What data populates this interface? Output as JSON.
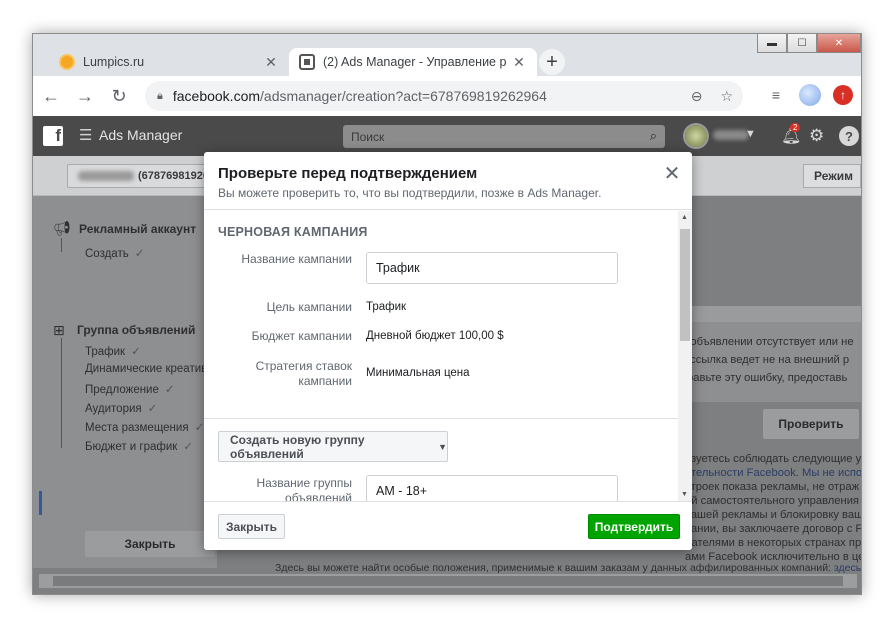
{
  "window": {
    "controls": {
      "minimize": "▬",
      "maximize": "☐",
      "close": "✕"
    }
  },
  "tabs": [
    {
      "title": "Lumpics.ru",
      "icon": "orange-circle-favicon",
      "close": "✕"
    },
    {
      "title": "(2) Ads Manager - Управление р",
      "icon": "ads-manager-favicon",
      "close": "✕"
    }
  ],
  "new_tab": "+",
  "toolbar": {
    "back": "←",
    "forward": "→",
    "reload": "↻",
    "url_host": "facebook.com",
    "url_path": "/adsmanager/creation?act=678769819262964"
  },
  "fb": {
    "logo": "f",
    "menu": "☰",
    "app_title": "Ads Manager",
    "search_placeholder": "Поиск",
    "notification_count": "2",
    "help": "?"
  },
  "subbar": {
    "account_id_suffix": "(67876981926",
    "mode_label": "Режим"
  },
  "left_panel": {
    "account_title": "Рекламный аккаунт",
    "account_items": [
      {
        "label": "Создать"
      }
    ],
    "adset_title": "Группа объявлений",
    "adset_items": [
      {
        "label": "Трафик"
      },
      {
        "label": "Динамические креатив"
      },
      {
        "label": "Предложение"
      },
      {
        "label": "Аудитория"
      },
      {
        "label": "Места размещения"
      },
      {
        "label": "Бюджет и график"
      }
    ],
    "close_label": "Закрыть"
  },
  "right_panel": {
    "lines_top": [
      "и объявлении отсутствует или не",
      "я ссылка ведет не на внешний р",
      "правьте эту ошибку, предоставь"
    ],
    "check_label": "Проверить",
    "lines_bottom": [
      "язуетесь соблюдать следующие ус",
      "ательности Facebook. Мы не испол",
      "строек показа рекламы, не отраж",
      "ий самостоятельного управления р",
      "вашей рекламы и блокировку ваше",
      "пании, вы заключаете договор с F",
      "дателями в некоторых странах при ол",
      "ами Facebook исключительно в це"
    ],
    "last_line": "Здесь вы можете найти особые положения, применимые к вашим заказам у данных аффилированных компаний:",
    "last_link": "здесь"
  },
  "modal": {
    "title": "Проверьте перед подтверждением",
    "subtitle": "Вы можете проверить то, что вы подтвердили, позже в Ads Manager.",
    "close_icon": "✕",
    "section_title": "ЧЕРНОВАЯ КАМПАНИЯ",
    "fields": {
      "campaign_name_label": "Название кампании",
      "campaign_name_value": "Трафик",
      "objective_label": "Цель кампании",
      "objective_value": "Трафик",
      "budget_label": "Бюджет кампании",
      "budget_value": "Дневной бюджет 100,00 $",
      "bid_label": "Стратегия ставок кампании",
      "bid_value": "Минимальная цена"
    },
    "create_adset_label": "Создать новую группу объявлений",
    "adset_name_label": "Название группы объявлений",
    "adset_name_value": "AM - 18+",
    "footer": {
      "close_label": "Закрыть",
      "confirm_label": "Подтвердить"
    }
  },
  "colors": {
    "confirm_green": "#00a400",
    "fb_bar": "#4a4a4a",
    "chrome_tabstrip": "#dee1e6"
  }
}
